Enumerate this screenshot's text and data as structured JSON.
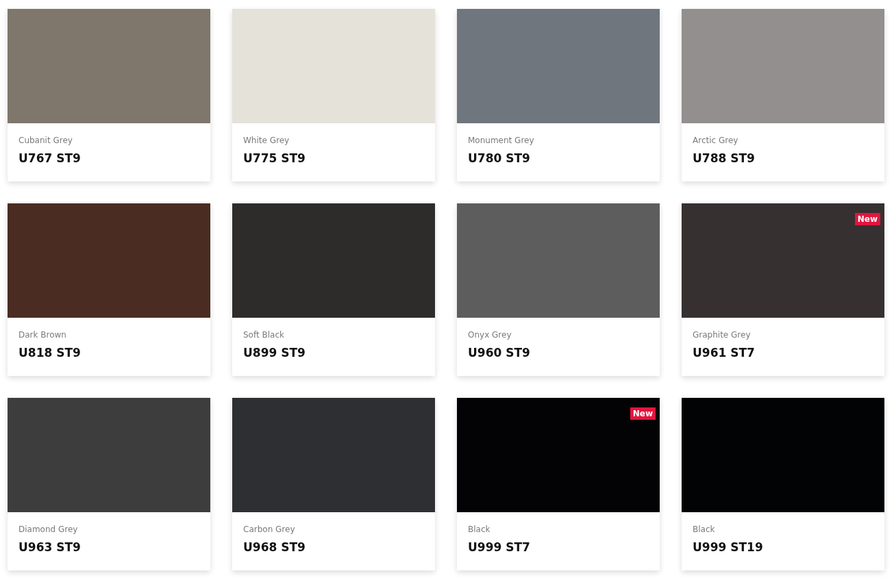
{
  "swatches": [
    {
      "name": "Cubanit Grey",
      "code": "U767 ST9",
      "color": "#7f776c"
    },
    {
      "name": "White Grey",
      "code": "U775 ST9",
      "color": "#e4e2d9"
    },
    {
      "name": "Monument Grey",
      "code": "U780 ST9",
      "color": "#70767d"
    },
    {
      "name": "Arctic Grey",
      "code": "U788 ST9",
      "color": "#938f8e"
    },
    {
      "name": "Dark Brown",
      "code": "U818 ST9",
      "color": "#4a2c22"
    },
    {
      "name": "Soft Black",
      "code": "U899 ST9",
      "color": "#2d2c2b"
    },
    {
      "name": "Onyx Grey",
      "code": "U960 ST9",
      "color": "#5d5d5d"
    },
    {
      "name": "Graphite Grey",
      "code": "U961 ST7",
      "color": "#363030",
      "badge": "New"
    },
    {
      "name": "Diamond Grey",
      "code": "U963 ST9",
      "color": "#3d3d3d"
    },
    {
      "name": "Carbon Grey",
      "code": "U968 ST9",
      "color": "#2e2f32"
    },
    {
      "name": "Black",
      "code": "U999 ST7",
      "color": "#030305",
      "badge": "New"
    },
    {
      "name": "Black",
      "code": "U999 ST19",
      "color": "#020305"
    }
  ]
}
